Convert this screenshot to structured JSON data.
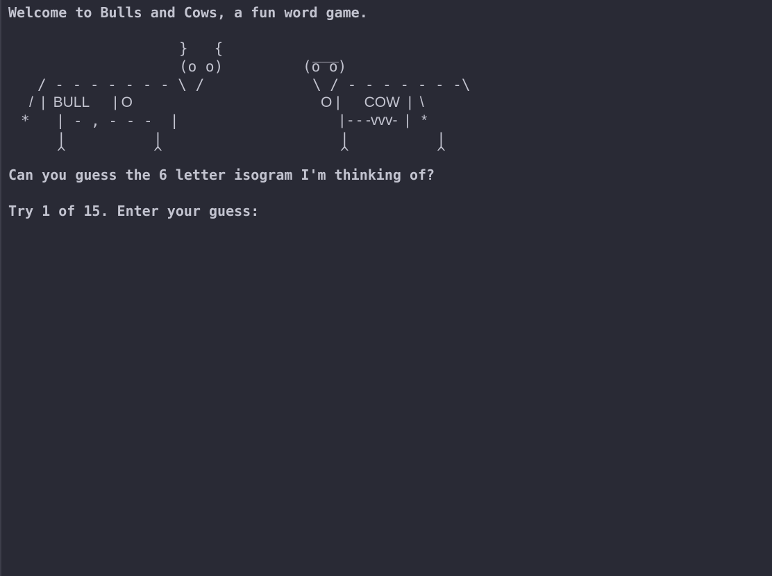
{
  "console": {
    "welcome": "Welcome to Bulls and Cows, a fun word game.",
    "art": {
      "bull_horns": "}   {",
      "bull_face": "(o o)",
      "bull_back": "/ - - - - - - - \\ /",
      "bull_neck": "/  |  BULL      | O",
      "bull_body": "*   | - , - - -  |",
      "bull_legs_upper": "|          |",
      "bull_hooves": "^          ^",
      "cow_hair": "___",
      "cow_face": "(o o)",
      "cow_back": "\\ / - - - - - - -\\",
      "cow_neck": "O |      COW  |  \\",
      "cow_body": "| - - -vvv-  |   *",
      "cow_legs_upper": "|          |",
      "cow_hooves": "^          ^"
    },
    "question": "Can you guess the 6 letter isogram I'm thinking of?",
    "prompt": "Try 1 of 15. Enter your guess:"
  }
}
